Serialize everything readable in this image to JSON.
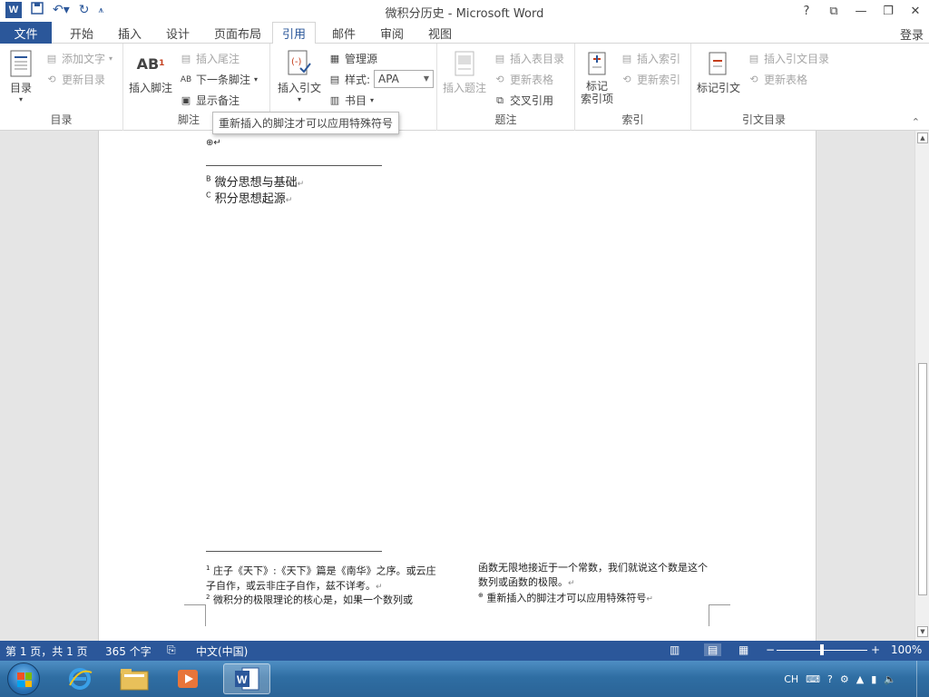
{
  "window": {
    "title": "微积分历史 - Microsoft Word",
    "controls": [
      "?",
      "⧉",
      "—",
      "❐",
      "✕"
    ]
  },
  "tabs": {
    "file": "文件",
    "items": [
      "开始",
      "插入",
      "设计",
      "页面布局",
      "引用",
      "邮件",
      "审阅",
      "视图"
    ],
    "active": "引用",
    "login": "登录"
  },
  "ribbon": {
    "toc": {
      "button": "目录",
      "add_text": "添加文字",
      "update_toc": "更新目录",
      "label": "目录"
    },
    "footnotes": {
      "insert_footnote": "插入脚注",
      "insert_endnote": "插入尾注",
      "next_footnote": "下一条脚注",
      "show_notes": "显示备注",
      "label": "脚注"
    },
    "citations": {
      "insert_citation": "插入引文",
      "manage_sources": "管理源",
      "style_label": "样式:",
      "style_value": "APA",
      "bibliography": "书目"
    },
    "captions": {
      "insert_caption": "插入题注",
      "insert_table_of_figures": "插入表目录",
      "update_table": "更新表格",
      "cross_reference": "交叉引用",
      "label": "题注"
    },
    "index": {
      "mark_entry": "标记\n索引项",
      "insert_index": "插入索引",
      "update_index": "更新索引",
      "label": "索引"
    },
    "toa": {
      "mark_citation": "标记引文",
      "insert_toa": "插入引文目录",
      "update_table": "更新表格",
      "label": "引文目录"
    },
    "tooltip": "重新插入的脚注才可以应用特殊符号"
  },
  "document": {
    "top_mark": "⊕↵",
    "endnote_b": {
      "sup": "B",
      "text": "微分思想与基础"
    },
    "endnote_c": {
      "sup": "C",
      "text": "积分思想起源"
    },
    "footnote_1": {
      "sup": "1",
      "text": "庄子《天下》:《天下》篇是《南华》之序。或云庄子自作，或云非庄子自作，兹不详考。"
    },
    "footnote_2": {
      "sup": "2",
      "text": "微积分的极限理论的核心是，如果一个数列或"
    },
    "footnote_2_cont": "函数无限地接近于一个常数，我们就说这个数是这个数列或函数的极限。",
    "footnote_special": {
      "sup": "⊕",
      "text": "重新插入的脚注才可以应用特殊符号"
    }
  },
  "status": {
    "page": "第 1 页，共 1 页",
    "words": "365 个字",
    "language": "中文(中国)",
    "zoom": "100%",
    "zoom_level": 1.0
  },
  "taskbar": {
    "tray_lang": "CH"
  }
}
